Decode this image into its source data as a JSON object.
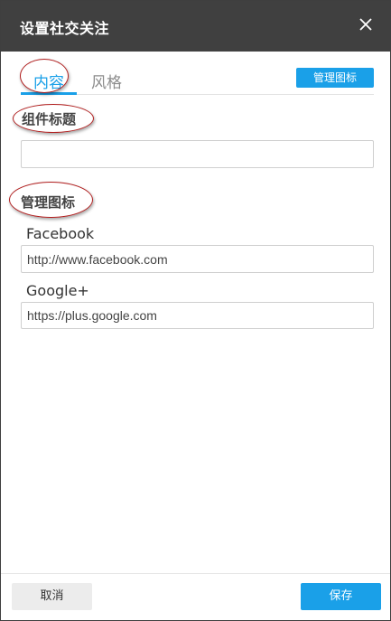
{
  "dialog": {
    "title": "设置社交关注",
    "close_icon": "close-icon"
  },
  "tabs": [
    {
      "label": "内容",
      "active": true
    },
    {
      "label": "风格",
      "active": false
    }
  ],
  "manage_icons_button": "管理图标",
  "widget_title": {
    "label": "组件标题",
    "value": ""
  },
  "manage_icons_section": {
    "label": "管理图标",
    "items": [
      {
        "name": "Facebook",
        "url": "http://www.facebook.com"
      },
      {
        "name": "Google+",
        "url": "https://plus.google.com"
      }
    ]
  },
  "footer": {
    "cancel_label": "取消",
    "save_label": "保存"
  },
  "colors": {
    "accent": "#1aa0e8",
    "titlebar": "#404040",
    "annotation": "#b01e1e"
  }
}
